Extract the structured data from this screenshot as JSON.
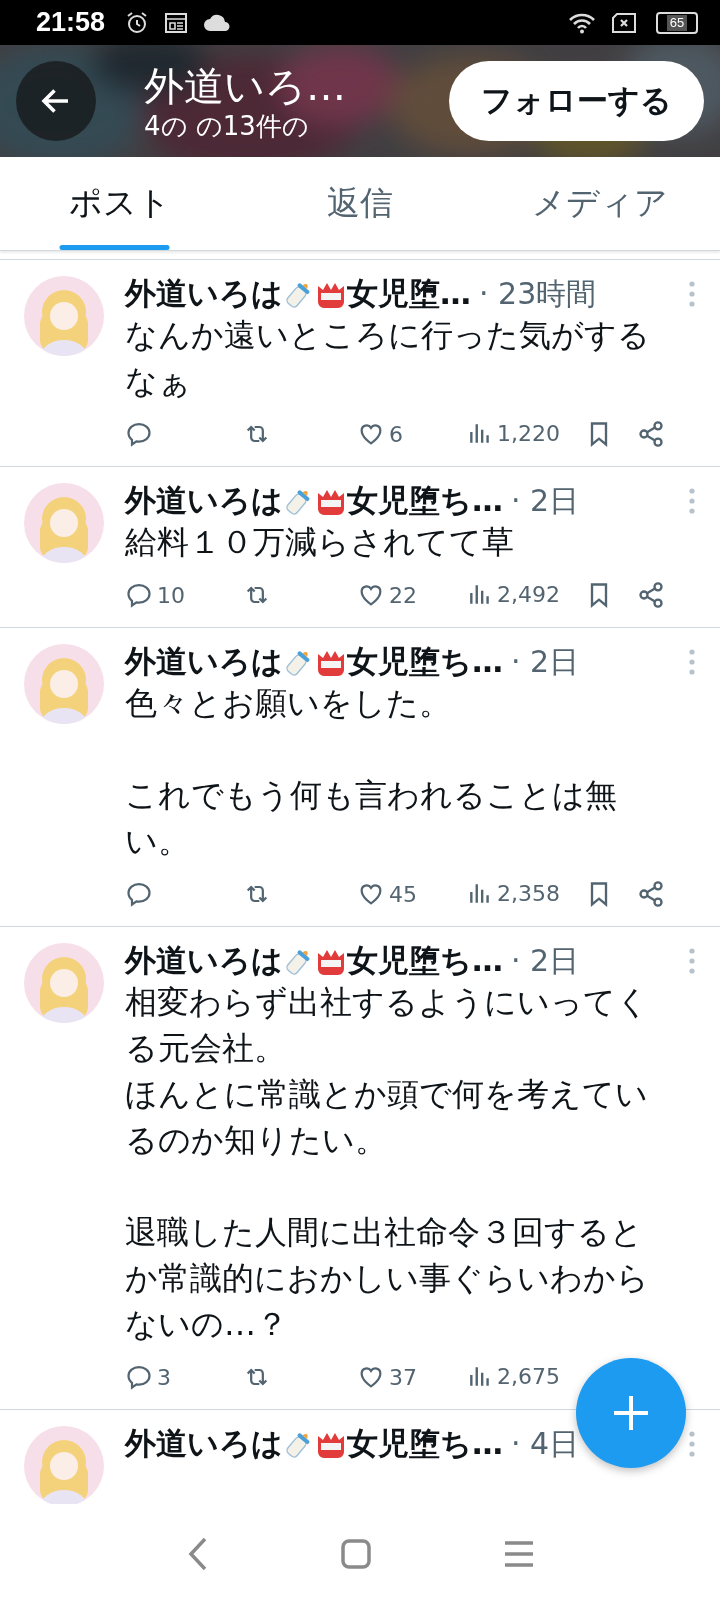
{
  "status_bar": {
    "time": "21:58",
    "battery": "65"
  },
  "header": {
    "title": "外道いろ…",
    "subtitle": "4の の13件の",
    "follow_button": "フォローする"
  },
  "tabs": [
    {
      "label": "ポスト",
      "selected": true
    },
    {
      "label": "返信",
      "selected": false
    },
    {
      "label": "メディア",
      "selected": false
    }
  ],
  "posts": [
    {
      "name": "外道いろは",
      "name_rest": "女児堕…",
      "time": "· 23時間",
      "paragraphs": [
        [
          "なんか遠いところに行った気がするなぁ"
        ]
      ],
      "likes": "6",
      "views": "1,220",
      "trailing_actions_visible": true
    },
    {
      "name": "外道いろは",
      "name_rest": "女児堕ち…",
      "time": "· 2日",
      "paragraphs": [
        [
          "給料１０万減らされてて草"
        ]
      ],
      "replies": "10",
      "likes": "22",
      "views": "2,492",
      "trailing_actions_visible": true
    },
    {
      "name": "外道いろは",
      "name_rest": "女児堕ち…",
      "time": "· 2日",
      "paragraphs": [
        [
          "色々とお願いをした。"
        ],
        [
          "これでもう何も言われることは無い。"
        ]
      ],
      "likes": "45",
      "views": "2,358",
      "trailing_actions_visible": true
    },
    {
      "name": "外道いろは",
      "name_rest": "女児堕ち…",
      "time": "· 2日",
      "paragraphs": [
        [
          "相変わらず出社するようにいってくる元会社。",
          "ほんとに常識とか頭で何を考えているのか知りたい。"
        ],
        [
          "退職した人間に出社命令３回するとか常識的におかしい事ぐらいわからないの…？"
        ]
      ],
      "replies": "3",
      "likes": "37",
      "views": "2,675",
      "trailing_actions_visible": false
    },
    {
      "name": "外道いろは",
      "name_rest": "女児堕ち…",
      "time": "· 4日"
    }
  ]
}
